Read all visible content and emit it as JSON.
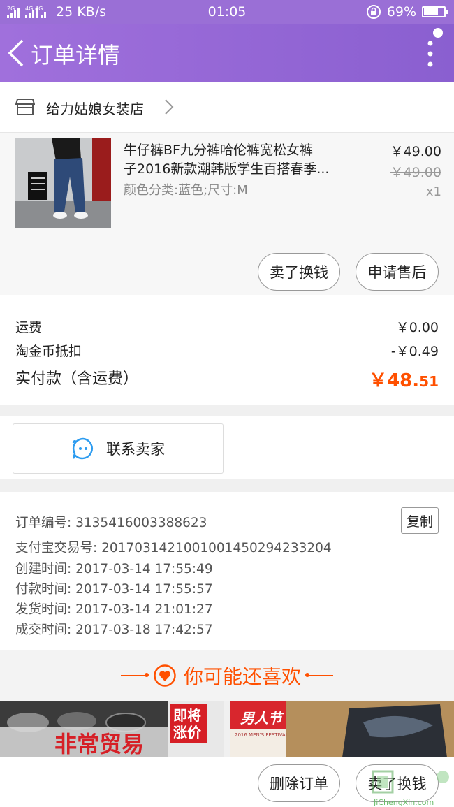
{
  "status_bar": {
    "signal_text": "2G 4G 4G",
    "speed": "25 KB/s",
    "time": "01:05",
    "battery": "69%"
  },
  "header": {
    "title": "订单详情"
  },
  "shop": {
    "name": "给力姑娘女装店"
  },
  "item": {
    "name_line1": "牛仔裤BF九分裤哈伦裤宽松女裤",
    "name_line2": "子2016新款潮韩版学生百搭春季...",
    "variant": "颜色分类:蓝色;尺寸:M",
    "price": "￥49.00",
    "original_price": "￥49.00",
    "quantity": "x1",
    "sell_button": "卖了换钱",
    "aftersale_button": "申请售后"
  },
  "fees": {
    "shipping_label": "运费",
    "shipping_value": "￥0.00",
    "coin_label": "淘金币抵扣",
    "coin_value": "-￥0.49",
    "total_label": "实付款（含运费）",
    "total_int": "￥48.",
    "total_dec": "51"
  },
  "contact": {
    "label": "联系卖家"
  },
  "order_info": {
    "order_no": "订单编号: 3135416003388623",
    "alipay_no": "支付宝交易号: 2017031421001001450294233204",
    "created": "创建时间: 2017-03-14 17:55:49",
    "paid": "付款时间: 2017-03-14 17:55:57",
    "shipped": "发货时间: 2017-03-14 21:01:27",
    "completed": "成交时间: 2017-03-18 17:42:57",
    "copy_button": "复制"
  },
  "recommend": {
    "title": "你可能还喜欢",
    "card1_text": "非常贸易",
    "card1_badge_line1": "即将",
    "card1_badge_line2": "涨价",
    "card2_badge": "男人节",
    "card2_sub": "2016 MEN'S FESTIVAL"
  },
  "bottom_bar": {
    "delete_button": "删除订单",
    "sell_button": "卖了换钱"
  },
  "watermark": {
    "text": "JiChengXin.com"
  },
  "colors": {
    "header": "#9a6fd6",
    "accent": "#ff5000",
    "contact_icon": "#2d9cf0"
  }
}
